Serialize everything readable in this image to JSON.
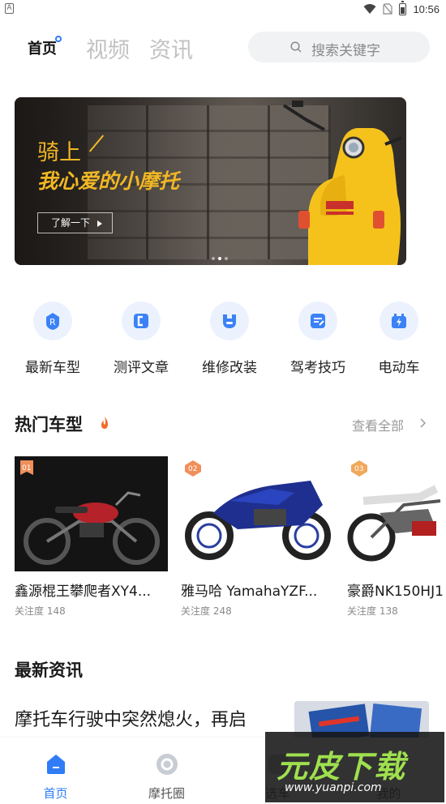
{
  "status_bar": {
    "time": "10:56",
    "left_icon_letter": "A"
  },
  "header": {
    "tabs": [
      {
        "label": "首页",
        "active": true
      },
      {
        "label": "视频",
        "active": false
      },
      {
        "label": "资讯",
        "active": false
      }
    ],
    "search_placeholder": "搜索关键字"
  },
  "banner": {
    "line1": "骑上",
    "line2": "我心爱的小摩托",
    "button_label": "了解一下",
    "dot_count": 3,
    "active_dot": 1,
    "accent_color": "#f2b824"
  },
  "quick_nav": [
    {
      "label": "最新车型",
      "icon": "new-model-icon"
    },
    {
      "label": "测评文章",
      "icon": "review-article-icon"
    },
    {
      "label": "维修改装",
      "icon": "repair-modify-icon"
    },
    {
      "label": "驾考技巧",
      "icon": "driving-test-icon"
    },
    {
      "label": "电动车",
      "icon": "electric-vehicle-icon"
    }
  ],
  "hot_models": {
    "title": "热门车型",
    "see_all": "查看全部",
    "items": [
      {
        "rank": "01",
        "title": "鑫源棍王攀爬者XY4...",
        "meta": "关注度 148"
      },
      {
        "rank": "02",
        "title": "雅马哈 YamahaYZF...",
        "meta": "关注度 248"
      },
      {
        "rank": "03",
        "title": "豪爵NK150HJ1",
        "meta": "关注度 138"
      }
    ]
  },
  "news": {
    "title": "最新资讯",
    "headline": "摩托车行驶中突然熄火，再启"
  },
  "bottom_nav": [
    {
      "label": "首页",
      "icon": "home-icon",
      "active": true
    },
    {
      "label": "摩托圈",
      "icon": "moto-circle-icon",
      "active": false
    },
    {
      "label": "选车",
      "icon": "select-car-icon",
      "active": false
    },
    {
      "label": "我的",
      "icon": "profile-icon",
      "active": false
    }
  ],
  "watermark": {
    "text": "元皮下载",
    "url": "www.yuanpi.com"
  },
  "colors": {
    "brand_blue": "#2f7cf6",
    "rank_badge": "#f08f5a",
    "fire": "#f26b2a"
  }
}
